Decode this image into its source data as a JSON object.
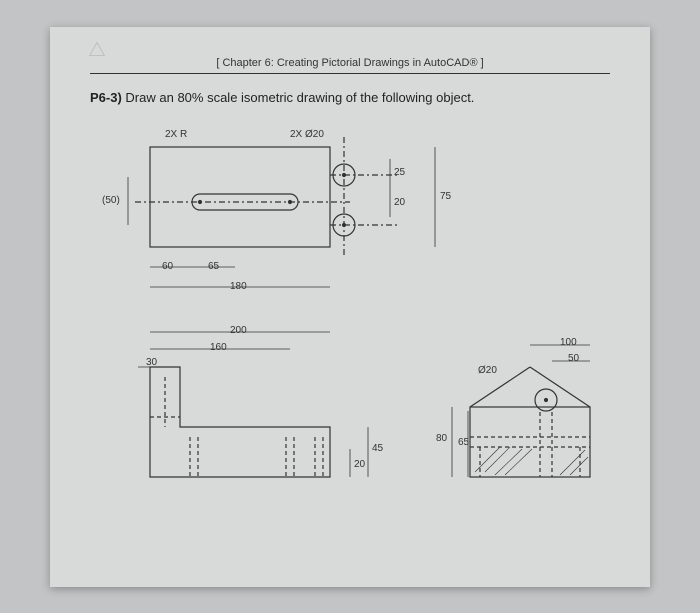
{
  "chapter": "[ Chapter 6: Creating Pictorial Drawings in AutoCAD® ]",
  "problem_id": "P6-3)",
  "problem_text": "Draw an 80% scale isometric drawing of the following object.",
  "labels": {
    "two_x_r": "2X R",
    "two_x_dia20": "2X Ø20",
    "dia20": "Ø20"
  },
  "dims": {
    "d50": "(50)",
    "d60": "60",
    "d65a": "65",
    "d180": "180",
    "d200": "200",
    "d160": "160",
    "d30": "30",
    "d25": "25",
    "d20a": "20",
    "d75": "75",
    "d20b": "20",
    "d45": "45",
    "d80": "80",
    "d65b": "65",
    "d100": "100",
    "d50b": "50"
  }
}
